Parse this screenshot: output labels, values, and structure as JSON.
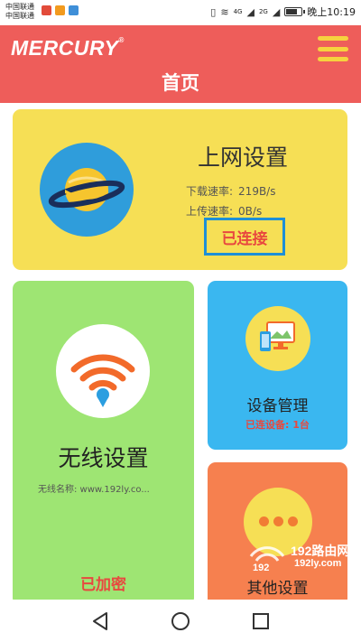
{
  "status_bar": {
    "carrier_1": "中国联通",
    "carrier_2": "中国联通",
    "network_1": "4G",
    "network_2": "2G",
    "time": "晚上10:19",
    "battery_level": 0.8
  },
  "header": {
    "logo": "MERCURY",
    "logo_mark": "®",
    "title": "首页"
  },
  "internet_card": {
    "title": "上网设置",
    "download_label": "下载速率:",
    "download_value": "219B/s",
    "upload_label": "上传速率:",
    "upload_value": "0B/s",
    "status": "已连接",
    "icon": "planet-icon"
  },
  "wireless_card": {
    "title": "无线设置",
    "ssid_text": "无线名称: www.192ly.co...",
    "status": "已加密",
    "icon": "wifi-icon"
  },
  "devices_card": {
    "title": "设备管理",
    "subtitle": "已连设备: 1台",
    "icon": "devices-icon"
  },
  "other_card": {
    "title": "其他设置",
    "icon": "more-icon"
  },
  "watermark": {
    "text_1": "192路由网",
    "text_2": "192ly.com",
    "number": "192"
  },
  "nav": {
    "back": "back-icon",
    "home": "home-icon",
    "recent": "recent-apps-icon"
  },
  "colors": {
    "header": "#ee5d5a",
    "internet_card": "#f6df55",
    "wireless_card": "#9ee573",
    "devices_card": "#3ab7f0",
    "other_card": "#f6804f",
    "accent_red": "#e8483f",
    "highlight_border": "#1e8fd6"
  }
}
